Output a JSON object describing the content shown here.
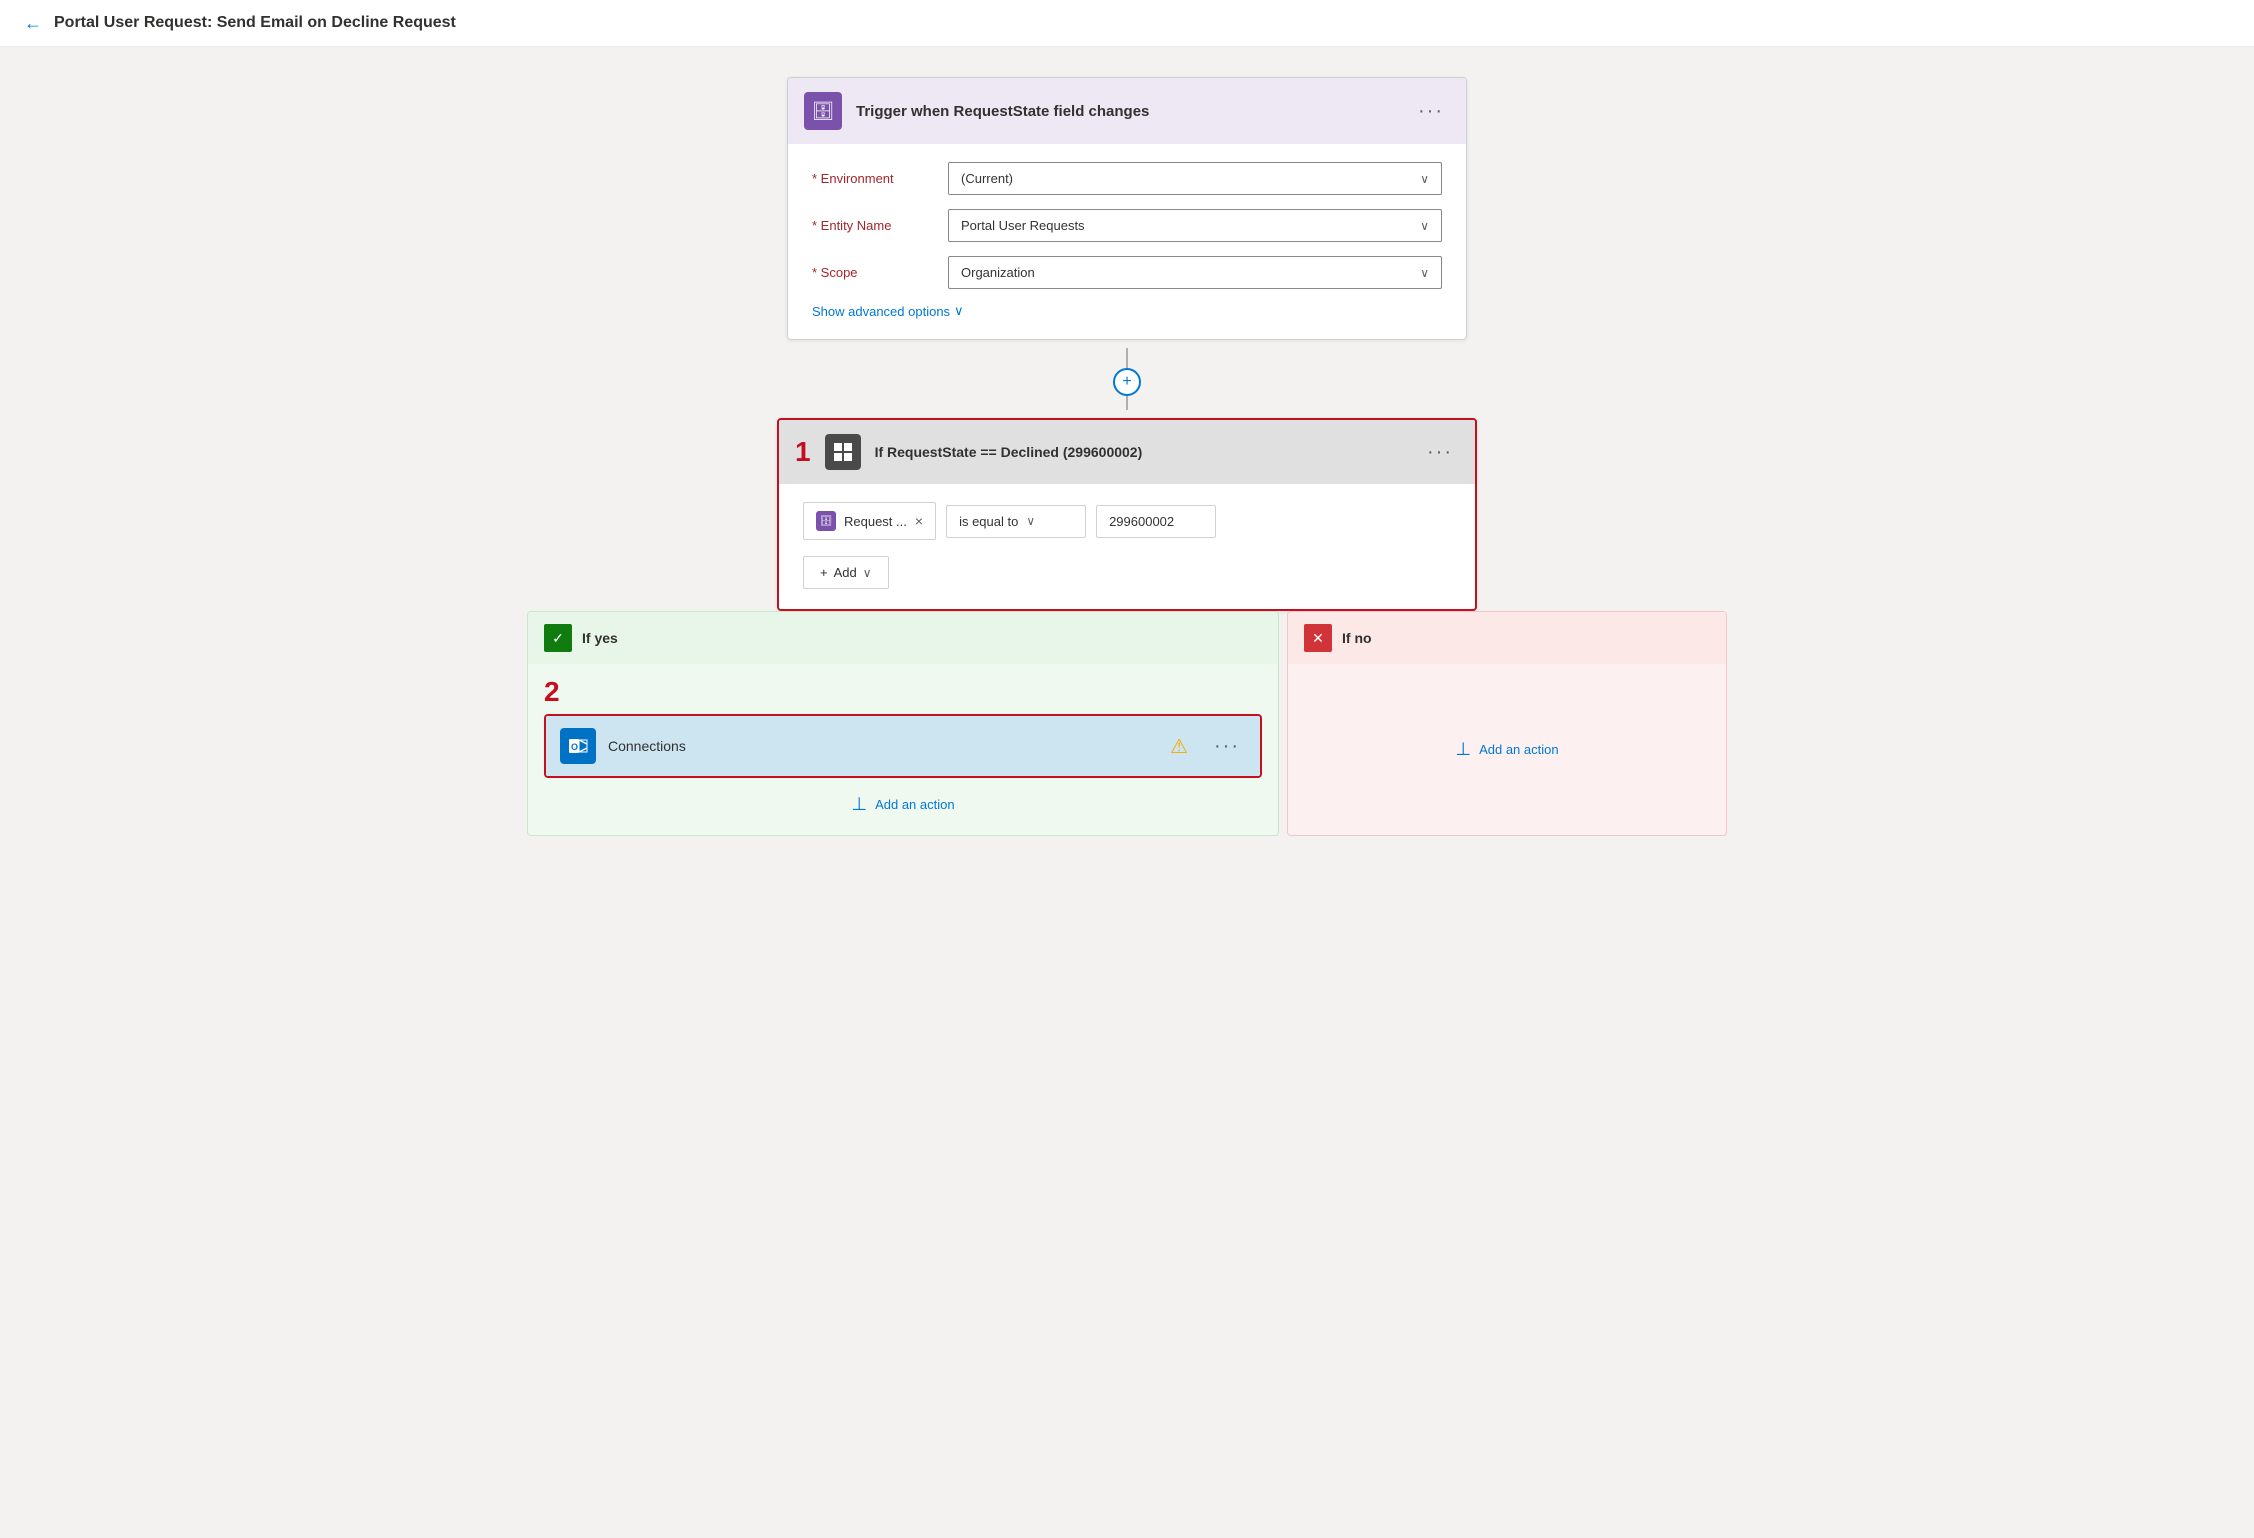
{
  "header": {
    "back_label": "←",
    "title": "Portal User Request: Send Email on Decline Request"
  },
  "trigger": {
    "icon": "🗄",
    "title": "Trigger when RequestState field changes",
    "ellipsis": "···",
    "environment_label": "Environment",
    "environment_value": "(Current)",
    "entity_label": "Entity Name",
    "entity_value": "Portal User Requests",
    "scope_label": "Scope",
    "scope_value": "Organization",
    "show_advanced": "Show advanced options",
    "show_advanced_chevron": "∨"
  },
  "condition": {
    "step_number": "1",
    "icon": "⊞",
    "title": "If RequestState == Declined (299600002)",
    "ellipsis": "···",
    "tag_label": "Request ...",
    "operator": "is equal to",
    "value": "299600002",
    "add_label": "+ Add",
    "add_chevron": "∨"
  },
  "branch_yes": {
    "header_label": "If yes",
    "checkmark": "✓",
    "connection_name": "Connections",
    "warning": "⚠",
    "ellipsis": "···",
    "add_action_label": "Add an action"
  },
  "branch_no": {
    "header_label": "If no",
    "x_mark": "✕",
    "add_action_label": "Add an action"
  },
  "step_number_2": "2",
  "connector_plus": "+"
}
